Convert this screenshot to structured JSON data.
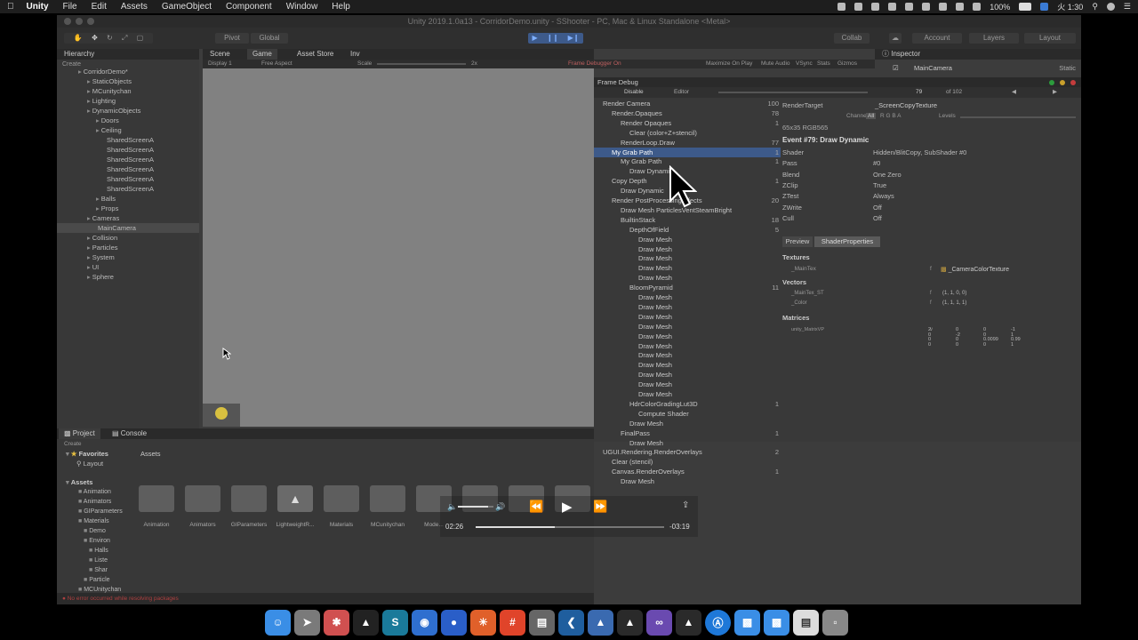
{
  "menubar": {
    "app": "Unity",
    "items": [
      "File",
      "Edit",
      "Assets",
      "GameObject",
      "Component",
      "Window",
      "Help"
    ],
    "battery": "100%",
    "clock": "火 1:30"
  },
  "window": {
    "title": "Unity 2019.1.0a13 - CorridorDemo.unity - SShooter - PC, Mac & Linux Standalone <Metal>"
  },
  "toolbar": {
    "pivot": "Pivot",
    "global": "Global",
    "collab": "Collab",
    "account": "Account",
    "layers": "Layers",
    "layout": "Layout"
  },
  "hierarchy": {
    "tab": "Hierarchy",
    "create": "Create",
    "items": [
      {
        "label": "CorridorDemo*",
        "level": 0
      },
      {
        "label": "StaticObjects",
        "level": 1
      },
      {
        "label": "MCunitychan",
        "level": 1
      },
      {
        "label": "Lighting",
        "level": 1
      },
      {
        "label": "DynamicObjects",
        "level": 1
      },
      {
        "label": "Doors",
        "level": 2
      },
      {
        "label": "Ceiling",
        "level": 2
      },
      {
        "label": "SharedScreenA",
        "level": 3
      },
      {
        "label": "SharedScreenA",
        "level": 3
      },
      {
        "label": "SharedScreenA",
        "level": 3
      },
      {
        "label": "SharedScreenA",
        "level": 3
      },
      {
        "label": "SharedScreenA",
        "level": 3
      },
      {
        "label": "SharedScreenA",
        "level": 3
      },
      {
        "label": "Balls",
        "level": 2
      },
      {
        "label": "Props",
        "level": 2
      },
      {
        "label": "Cameras",
        "level": 1
      },
      {
        "label": "MainCamera",
        "level": 2
      },
      {
        "label": "Collision",
        "level": 1
      },
      {
        "label": "Particles",
        "level": 1
      },
      {
        "label": "System",
        "level": 1
      },
      {
        "label": "UI",
        "level": 1
      },
      {
        "label": "Sphere",
        "level": 1
      }
    ]
  },
  "center_tabs": {
    "scene": "Scene",
    "game": "Game",
    "asset_store": "Asset Store",
    "inv": "Inv",
    "display": "Display 1",
    "aspect": "Free Aspect",
    "scale": "Scale",
    "scale_value": "2x",
    "frame_debugger_on": "Frame Debugger On",
    "maximize": "Maximize On Play",
    "mute": "Mute Audio",
    "vsync": "VSync",
    "stats": "Stats",
    "gizmos": "Gizmos"
  },
  "inspector": {
    "tab": "Inspector",
    "object": "MainCamera",
    "static": "Static"
  },
  "frame_debug": {
    "title": "Frame Debug",
    "disable": "Disable",
    "editor": "Editor",
    "current": "79",
    "of": "of 102",
    "tree": [
      {
        "label": "Render Camera",
        "indent": 0,
        "count": "100"
      },
      {
        "label": "Render.Opaques",
        "indent": 1,
        "count": "78"
      },
      {
        "label": "Render Opaques",
        "indent": 2,
        "count": "1"
      },
      {
        "label": "Clear (color+Z+stencil)",
        "indent": 3,
        "count": ""
      },
      {
        "label": "RenderLoop.Draw",
        "indent": 2,
        "count": "77"
      },
      {
        "label": "My Grab Path",
        "indent": 1,
        "count": "1",
        "selected": true
      },
      {
        "label": "My Grab Path",
        "indent": 2,
        "count": "1"
      },
      {
        "label": "Draw Dynamic",
        "indent": 3,
        "count": ""
      },
      {
        "label": "Copy Depth",
        "indent": 1,
        "count": "1"
      },
      {
        "label": "Draw Dynamic",
        "indent": 2,
        "count": ""
      },
      {
        "label": "Render PostProcessingEffects",
        "indent": 1,
        "count": "20"
      },
      {
        "label": "Draw Mesh ParticlesVentSteamBright",
        "indent": 2,
        "count": ""
      },
      {
        "label": "BuiltinStack",
        "indent": 2,
        "count": "18"
      },
      {
        "label": "DepthOfField",
        "indent": 3,
        "count": "5"
      },
      {
        "label": "Draw Mesh",
        "indent": 4,
        "count": ""
      },
      {
        "label": "Draw Mesh",
        "indent": 4,
        "count": ""
      },
      {
        "label": "Draw Mesh",
        "indent": 4,
        "count": ""
      },
      {
        "label": "Draw Mesh",
        "indent": 4,
        "count": ""
      },
      {
        "label": "Draw Mesh",
        "indent": 4,
        "count": ""
      },
      {
        "label": "BloomPyramid",
        "indent": 3,
        "count": "11"
      },
      {
        "label": "Draw Mesh",
        "indent": 4,
        "count": ""
      },
      {
        "label": "Draw Mesh",
        "indent": 4,
        "count": ""
      },
      {
        "label": "Draw Mesh",
        "indent": 4,
        "count": ""
      },
      {
        "label": "Draw Mesh",
        "indent": 4,
        "count": ""
      },
      {
        "label": "Draw Mesh",
        "indent": 4,
        "count": ""
      },
      {
        "label": "Draw Mesh",
        "indent": 4,
        "count": ""
      },
      {
        "label": "Draw Mesh",
        "indent": 4,
        "count": ""
      },
      {
        "label": "Draw Mesh",
        "indent": 4,
        "count": ""
      },
      {
        "label": "Draw Mesh",
        "indent": 4,
        "count": ""
      },
      {
        "label": "Draw Mesh",
        "indent": 4,
        "count": ""
      },
      {
        "label": "Draw Mesh",
        "indent": 4,
        "count": ""
      },
      {
        "label": "HdrColorGradingLut3D",
        "indent": 3,
        "count": "1"
      },
      {
        "label": "Compute Shader",
        "indent": 4,
        "count": ""
      },
      {
        "label": "Draw Mesh",
        "indent": 3,
        "count": ""
      },
      {
        "label": "FinalPass",
        "indent": 2,
        "count": "1"
      },
      {
        "label": "Draw Mesh",
        "indent": 3,
        "count": ""
      },
      {
        "label": "UGUI.Rendering.RenderOverlays",
        "indent": 0,
        "count": "2"
      },
      {
        "label": "Clear (stencil)",
        "indent": 1,
        "count": ""
      },
      {
        "label": "Canvas.RenderOverlays",
        "indent": 1,
        "count": "1"
      },
      {
        "label": "Draw Mesh",
        "indent": 2,
        "count": ""
      }
    ],
    "render_target_label": "RenderTarget",
    "render_target_value": "_ScreenCopyTexture",
    "channels": "Channels",
    "all": "All",
    "levels": "Levels",
    "rt_size": "65x35 RGB565",
    "event": "Event #79: Draw Dynamic",
    "props": [
      {
        "key": "Shader",
        "value": "Hidden/BlitCopy, SubShader #0"
      },
      {
        "key": "Pass",
        "value": "#0"
      },
      {
        "key": "Blend",
        "value": "One Zero"
      },
      {
        "key": "ZClip",
        "value": "True"
      },
      {
        "key": "ZTest",
        "value": "Always"
      },
      {
        "key": "ZWrite",
        "value": "Off"
      },
      {
        "key": "Cull",
        "value": "Off"
      }
    ],
    "preview_tab": "Preview",
    "shader_props_tab": "ShaderProperties",
    "textures": "Textures",
    "maintex": "_MainTex",
    "maintex_value": "_CameraColorTexture",
    "vectors": "Vectors",
    "vec1": "_MainTex_ST",
    "vec1_value": "(1, 1, 0, 0)",
    "vec2": "_Color",
    "vec2_value": "(1, 1, 1, 1)",
    "matrices": "Matrices",
    "mat1": "unity_MatrixVP",
    "matrix_col1": [
      "2",
      "0",
      "0",
      "0"
    ],
    "matrix_col2": [
      "0",
      "-2",
      "0",
      "0"
    ],
    "matrix_col3": [
      "0",
      "0",
      "0.0099",
      "0"
    ],
    "matrix_col4": [
      "-1",
      "1",
      "0.99",
      "1"
    ]
  },
  "project": {
    "tab_project": "Project",
    "tab_console": "Console",
    "create": "Create",
    "favorites": "Favorites",
    "fav_layout": "Layout",
    "assets_root": "Assets",
    "breadcrumb": "Assets",
    "tree": [
      "Animation",
      "Animators",
      "GIParameters",
      "Materials",
      "Demo",
      "Environ",
      "Halls",
      "Liste",
      "Shar",
      "Particle",
      "MCUnitychan"
    ],
    "folders": [
      "Animation",
      "Animators",
      "GIParameters",
      "LightweightR...",
      "Materials",
      "MCunitychan",
      "Mode...",
      "",
      "",
      ""
    ]
  },
  "video": {
    "elapsed": "02:26",
    "remaining": "-03:19",
    "progress": 0.42,
    "volume": 0.85
  },
  "status_bar": {
    "message": "No error occurred while resolving packages"
  }
}
